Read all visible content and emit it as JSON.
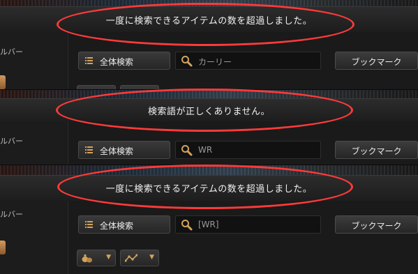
{
  "panels": [
    {
      "banner_message": "一度に検索できるアイテムの数を超過しました。",
      "sidebar_label": "ルバー",
      "category_label": "全体検索",
      "search_value": "カーリー",
      "bookmark_label": "ブックマーク"
    },
    {
      "banner_message": "検索語が正しくありません。",
      "sidebar_label": "ルバー",
      "category_label": "全体検索",
      "search_value": "WR",
      "bookmark_label": "ブックマーク"
    },
    {
      "banner_message": "一度に検索できるアイテムの数を超過しました。",
      "sidebar_label": "ルバー",
      "category_label": "全体検索",
      "search_value": "[WR]",
      "bookmark_label": "ブックマーク"
    }
  ],
  "icons": {
    "category": "list-icon",
    "search": "magnifier-icon",
    "filter_money": "money-bag-icon",
    "filter_chart": "line-chart-icon",
    "dropdown": "triangle-down-icon"
  },
  "colors": {
    "highlight_ellipse": "#ff3a3a",
    "icon_accent": "#d4a35c"
  }
}
